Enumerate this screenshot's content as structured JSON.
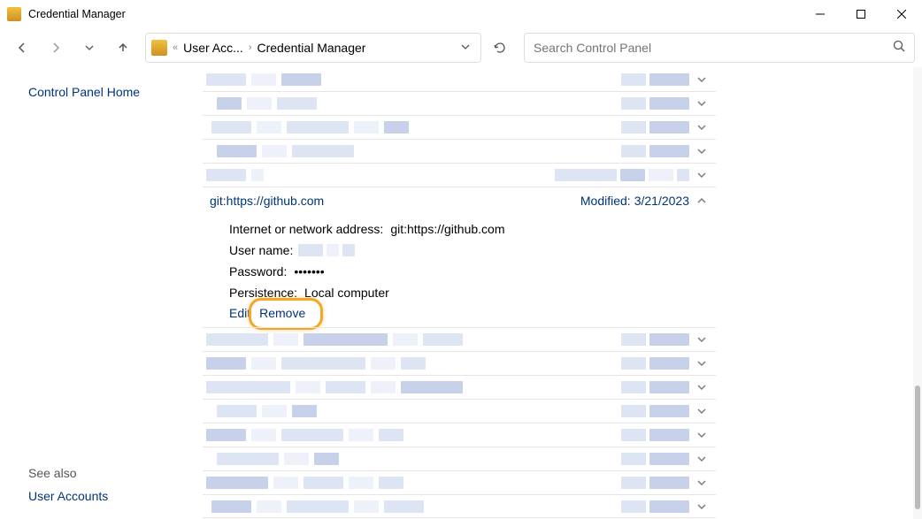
{
  "window": {
    "title": "Credential Manager"
  },
  "breadcrumb": {
    "part1": "User Acc...",
    "part2": "Credential Manager"
  },
  "search": {
    "placeholder": "Search Control Panel"
  },
  "sidebar": {
    "home": "Control Panel Home",
    "see_also": "See also",
    "user_accounts": "User Accounts"
  },
  "expanded": {
    "title": "git:https://github.com",
    "modified_label": "Modified:",
    "modified_date": "3/21/2023",
    "addr_label": "Internet or network address:",
    "addr_value": "git:https://github.com",
    "user_label": "User name:",
    "pass_label": "Password:",
    "pass_value": "•••••••",
    "persist_label": "Persistence:",
    "persist_value": "Local computer",
    "edit": "Edit",
    "remove": "Remove"
  }
}
